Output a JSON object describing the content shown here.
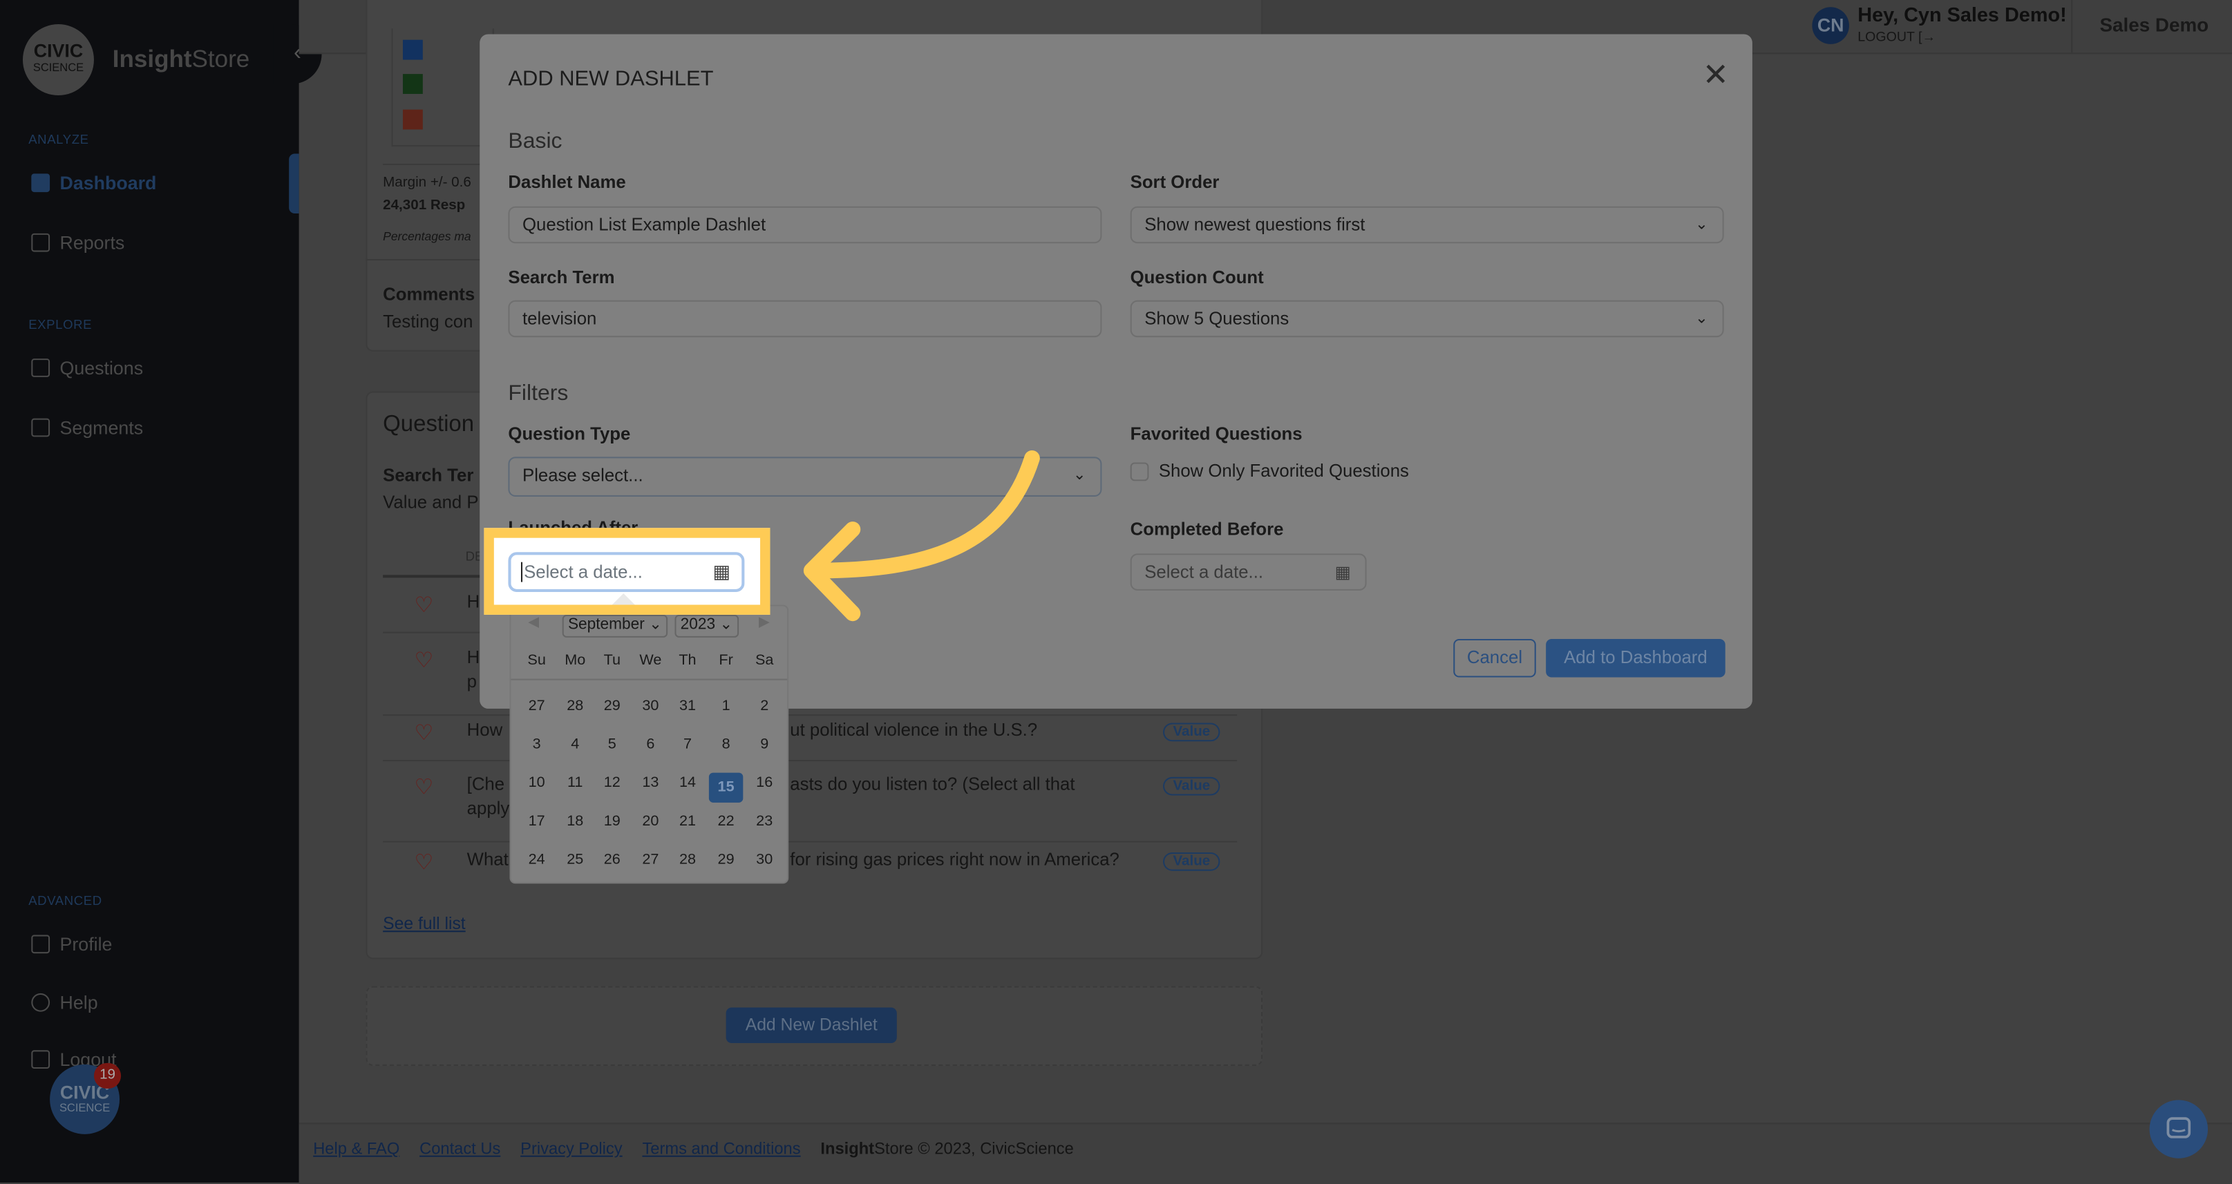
{
  "sidebar": {
    "logo": {
      "line1": "CIVIC",
      "line2": "SCIENCE"
    },
    "brand_bold": "Insight",
    "brand_rest": "Store",
    "sections": {
      "analyze": "ANALYZE",
      "explore": "EXPLORE",
      "advanced": "ADVANCED"
    },
    "items": {
      "dashboard": "Dashboard",
      "reports": "Reports",
      "questions": "Questions",
      "segments": "Segments",
      "profile": "Profile",
      "help": "Help",
      "logout": "Logout"
    },
    "chat": {
      "line1": "CIVIC",
      "line2": "SCIENCE",
      "badge": "19"
    }
  },
  "header": {
    "avatar": "CN",
    "greeting": "Hey, Cyn Sales Demo!",
    "logout": "LOGOUT",
    "account": "Sales Demo"
  },
  "background": {
    "legend_colors": [
      "#123260",
      "#133516",
      "#5e2419"
    ],
    "margin": "Margin +/- 0.6",
    "responses": "24,301 Resp",
    "note": "Percentages ma",
    "comments_title": "Comments",
    "comments_text": "Testing con",
    "question_title": "Question",
    "search_term": "Search Ter",
    "search_value": "Value and P",
    "col_header": "DE",
    "rows": [
      {
        "left": "H",
        "right": "",
        "cont": ""
      },
      {
        "left": "H",
        "right": "",
        "cont": "p"
      },
      {
        "left": "How",
        "right": "ut political violence in the U.S.?",
        "cont": "",
        "badge": "Value"
      },
      {
        "left": "[Che",
        "right": "asts do you listen to? (Select all that",
        "cont": "apply",
        "badge": "Value"
      },
      {
        "left": "What",
        "right": "for rising gas prices right now in America?",
        "cont": "",
        "badge": "Value"
      }
    ],
    "see_full_list": "See full list",
    "add_dashlet": "Add New Dashlet"
  },
  "modal": {
    "title": "ADD NEW DASHLET",
    "basic": "Basic",
    "dashlet_name_label": "Dashlet Name",
    "dashlet_name_value": "Question List Example Dashlet",
    "sort_order_label": "Sort Order",
    "sort_order_value": "Show newest questions first",
    "search_term_label": "Search Term",
    "search_term_value": "television",
    "question_count_label": "Question Count",
    "question_count_value": "Show 5 Questions",
    "filters": "Filters",
    "question_type_label": "Question Type",
    "question_type_value": "Please select...",
    "favorited_label": "Favorited Questions",
    "favorited_checkbox": "Show Only Favorited Questions",
    "favorited_checked": false,
    "launched_after_label": "Launched After",
    "launched_after_placeholder": "Select a date...",
    "completed_before_label": "Completed Before",
    "completed_before_placeholder": "Select a date...",
    "cancel": "Cancel",
    "add": "Add to Dashboard"
  },
  "calendar": {
    "month": "September",
    "year": "2023",
    "weekdays": [
      "Su",
      "Mo",
      "Tu",
      "We",
      "Th",
      "Fr",
      "Sa"
    ],
    "weeks": [
      [
        "27",
        "28",
        "29",
        "30",
        "31",
        "1",
        "2"
      ],
      [
        "3",
        "4",
        "5",
        "6",
        "7",
        "8",
        "9"
      ],
      [
        "10",
        "11",
        "12",
        "13",
        "14",
        "15",
        "16"
      ],
      [
        "17",
        "18",
        "19",
        "20",
        "21",
        "22",
        "23"
      ],
      [
        "24",
        "25",
        "26",
        "27",
        "28",
        "29",
        "30"
      ]
    ],
    "selected": "15"
  },
  "footer": {
    "links": [
      "Help & FAQ",
      "Contact Us",
      "Privacy Policy",
      "Terms and Conditions"
    ],
    "brand_bold": "Insight",
    "copyright": "Store © 2023, CivicScience"
  },
  "colors": {
    "highlight": "#fecb55",
    "accent": "#2b5283"
  }
}
